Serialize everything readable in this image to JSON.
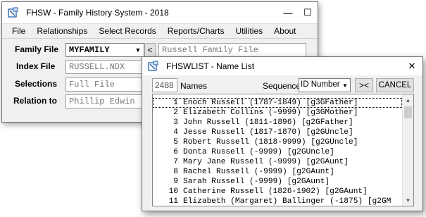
{
  "main_window": {
    "title": "FHSW - Family History System - 2018",
    "menu": [
      "File",
      "Relationships",
      "Select Records",
      "Reports/Charts",
      "Utilities",
      "About"
    ],
    "family_file": {
      "label": "Family File",
      "value": "MYFAMILY",
      "description": "Russell Family File"
    },
    "index_file": {
      "label": "Index File",
      "value": "RUSSELL.NDX"
    },
    "selections": {
      "label": "Selections",
      "value": "Full File"
    },
    "relation_to": {
      "label": "Relation to",
      "value": "Phillip Edwin"
    },
    "back_button": "<"
  },
  "list_window": {
    "title": "FHSWLIST - Name List",
    "count": "2488",
    "count_label": "Names",
    "sequence_label": "Sequence",
    "sequence_value": "ID Number",
    "jump_button": "><",
    "cancel_button": "CANCEL",
    "close_glyph": "✕",
    "rows": [
      {
        "num": "1",
        "text": "Enoch Russell  (1787-1849) [g3GFather]"
      },
      {
        "num": "2",
        "text": "Elizabeth Collins (-9999) [g3GMother]"
      },
      {
        "num": "3",
        "text": "John Russell  (1811-1896) [g2GFather]"
      },
      {
        "num": "4",
        "text": "Jesse Russell  (1817-1870) [g2GUncle]"
      },
      {
        "num": "5",
        "text": "Robert Russell  (1818-9999) [g2GUncle]"
      },
      {
        "num": "6",
        "text": "Donta Russell  (-9999) [g2GUncle]"
      },
      {
        "num": "7",
        "text": "Mary Jane Russell  (-9999) [g2GAunt]"
      },
      {
        "num": "8",
        "text": "Rachel Russell  (-9999) [g2GAunt]"
      },
      {
        "num": "9",
        "text": "Sarah Russell  (-9999) [g2GAunt]"
      },
      {
        "num": "10",
        "text": "Catherine Russell  (1826-1902) [g2GAunt]"
      },
      {
        "num": "11",
        "text": "Elizabeth (Margaret) Ballinger (-1875) [g2GM"
      }
    ]
  },
  "window_controls": {
    "minimize": "—",
    "maximize": "☐",
    "close": "✕"
  },
  "colors": {
    "selection_outline": "#000000",
    "window_bg": "#f0f0f0"
  }
}
